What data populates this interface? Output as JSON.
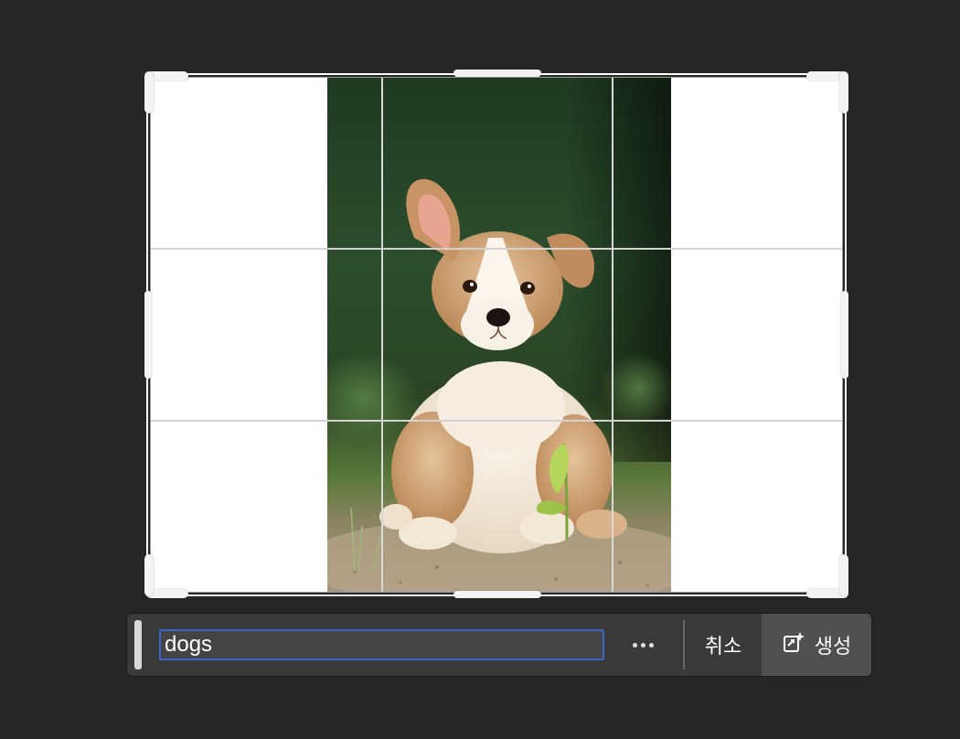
{
  "prompt": {
    "value": "dogs",
    "more_icon": "ellipsis-icon",
    "cancel_label": "취소",
    "generate_label": "생성",
    "generate_icon": "generative-expand-icon",
    "focus_color": "#3b66c8"
  },
  "canvas": {
    "fill_color": "#ffffff",
    "photo_subject": "corgi puppy"
  },
  "colors": {
    "background": "#262626",
    "toolbar": "#3a3a3a",
    "generate_bg": "#505050"
  }
}
